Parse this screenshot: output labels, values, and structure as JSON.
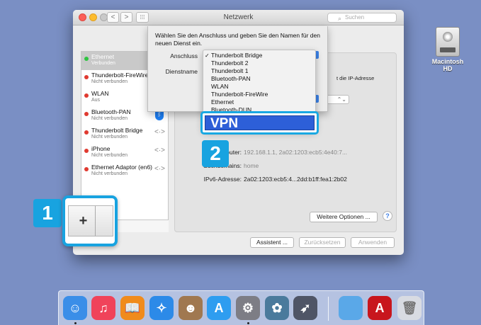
{
  "desktop": {
    "drive_label": "Macintosh\nHD",
    "drive_icon": "hard-drive-icon"
  },
  "window": {
    "title": "Netzwerk",
    "search_placeholder": "Suchen",
    "nav_back": "<",
    "nav_forward": ">",
    "grid": "⁞⁞⁞"
  },
  "sheet": {
    "instruction": "Wählen Sie den Anschluss und geben Sie den Namen für den neuen Dienst ein.",
    "anschluss_label": "Anschluss",
    "dienstname_label": "Dienstname"
  },
  "menu": {
    "items": [
      "Thunderbolt Bridge",
      "Thunderbolt 2",
      "Thunderbolt 1",
      "Bluetooth-PAN",
      "WLAN",
      "Thunderbolt-FireWire",
      "Ethernet",
      "Bluetooth-DUN"
    ],
    "checkmark": "✓",
    "highlighted_item": "VPN"
  },
  "sidebar": {
    "services": [
      {
        "name": "Ethernet",
        "status": "Verbunden",
        "color": "#2ec440"
      },
      {
        "name": "Thunderbolt-FireWire",
        "status": "Nicht verbunden",
        "color": "#e03a30"
      },
      {
        "name": "WLAN",
        "status": "Aus",
        "color": "#e03a30"
      },
      {
        "name": "Bluetooth-PAN",
        "status": "Nicht verbunden",
        "color": "#e03a30"
      },
      {
        "name": "Thunderbolt Bridge",
        "status": "Nicht verbunden",
        "color": "#e03a30"
      },
      {
        "name": "iPhone",
        "status": "Nicht verbunden",
        "color": "#e03a30"
      },
      {
        "name": "Ethernet Adaptor (en6)",
        "status": "Nicht verbunden",
        "color": "#e03a30"
      }
    ]
  },
  "pane": {
    "ipv4_note": "t die IP-Adresse",
    "router_label": "Router:",
    "router_value": "192.168.1.1, 2a02:1203:ecb5:4e40:7...",
    "dns_label": "Suchdomains:",
    "dns_value": "home",
    "ipv6_label": "IPv6-Adresse:",
    "ipv6_value": "2a02:1203:ecb5:4...2dd:b1ff:fea1:2b02",
    "popup_arrow": "⌃⌄",
    "advanced_button": "Weitere Optionen ...",
    "help_button": "?"
  },
  "footer": {
    "assistant_button": "Assistent ...",
    "revert_button": "Zurücksetzen",
    "apply_button": "Anwenden"
  },
  "callouts": {
    "step1": "1",
    "step2": "2",
    "plus": "+"
  },
  "dock": {
    "apps": [
      {
        "name": "finder-icon",
        "glyph": "☺",
        "color": "#3a8ee8"
      },
      {
        "name": "music-icon",
        "glyph": "♫",
        "color": "#f0435a"
      },
      {
        "name": "books-icon",
        "glyph": "📖",
        "color": "#f08b1c"
      },
      {
        "name": "safari-icon",
        "glyph": "✧",
        "color": "#2c8ae8"
      },
      {
        "name": "contacts-icon",
        "glyph": "☻",
        "color": "#a07850"
      },
      {
        "name": "app-store-icon",
        "glyph": "A",
        "color": "#2e9df0"
      },
      {
        "name": "system-preferences-icon",
        "glyph": "⚙",
        "color": "#7d7d85"
      },
      {
        "name": "photos-icon",
        "glyph": "✿",
        "color": "#4a7a9c"
      },
      {
        "name": "launchpad-icon",
        "glyph": "➶",
        "color": "#4f5566"
      },
      {
        "name": "folder-icon",
        "glyph": "",
        "color": "#5aa8e8"
      },
      {
        "name": "acrobat-icon",
        "glyph": "A",
        "color": "#c8161d"
      },
      {
        "name": "trash-icon",
        "glyph": "🗑",
        "color": "#d8dbe2"
      }
    ]
  }
}
